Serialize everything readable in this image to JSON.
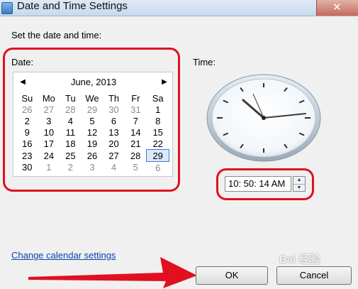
{
  "window": {
    "title": "Date and Time Settings"
  },
  "dialog": {
    "heading": "Set the date and time:",
    "date_label": "Date:",
    "time_label": "Time:",
    "calendar": {
      "month_title": "June, 2013",
      "weekdays": [
        "Su",
        "Mo",
        "Tu",
        "We",
        "Th",
        "Fr",
        "Sa"
      ],
      "weeks": [
        [
          {
            "d": "26",
            "o": true
          },
          {
            "d": "27",
            "o": true
          },
          {
            "d": "28",
            "o": true
          },
          {
            "d": "29",
            "o": true
          },
          {
            "d": "30",
            "o": true
          },
          {
            "d": "31",
            "o": true
          },
          {
            "d": "1",
            "o": false
          }
        ],
        [
          {
            "d": "2",
            "o": false
          },
          {
            "d": "3",
            "o": false
          },
          {
            "d": "4",
            "o": false
          },
          {
            "d": "5",
            "o": false
          },
          {
            "d": "6",
            "o": false
          },
          {
            "d": "7",
            "o": false
          },
          {
            "d": "8",
            "o": false
          }
        ],
        [
          {
            "d": "9",
            "o": false
          },
          {
            "d": "10",
            "o": false
          },
          {
            "d": "11",
            "o": false
          },
          {
            "d": "12",
            "o": false
          },
          {
            "d": "13",
            "o": false
          },
          {
            "d": "14",
            "o": false
          },
          {
            "d": "15",
            "o": false
          }
        ],
        [
          {
            "d": "16",
            "o": false
          },
          {
            "d": "17",
            "o": false
          },
          {
            "d": "18",
            "o": false
          },
          {
            "d": "19",
            "o": false
          },
          {
            "d": "20",
            "o": false
          },
          {
            "d": "21",
            "o": false
          },
          {
            "d": "22",
            "o": false
          }
        ],
        [
          {
            "d": "23",
            "o": false
          },
          {
            "d": "24",
            "o": false
          },
          {
            "d": "25",
            "o": false
          },
          {
            "d": "26",
            "o": false
          },
          {
            "d": "27",
            "o": false
          },
          {
            "d": "28",
            "o": false
          },
          {
            "d": "29",
            "o": false,
            "s": true
          }
        ],
        [
          {
            "d": "30",
            "o": false
          },
          {
            "d": "1",
            "o": true
          },
          {
            "d": "2",
            "o": true
          },
          {
            "d": "3",
            "o": true
          },
          {
            "d": "4",
            "o": true
          },
          {
            "d": "5",
            "o": true
          },
          {
            "d": "6",
            "o": true
          }
        ]
      ],
      "selected_day": "29"
    },
    "time_value": "10: 50: 14 AM",
    "link_text": "Change calendar settings",
    "ok_label": "OK",
    "cancel_label": "Cancel"
  },
  "annotations": {
    "highlight_color": "#e01020"
  },
  "watermark": "Bai 经验"
}
